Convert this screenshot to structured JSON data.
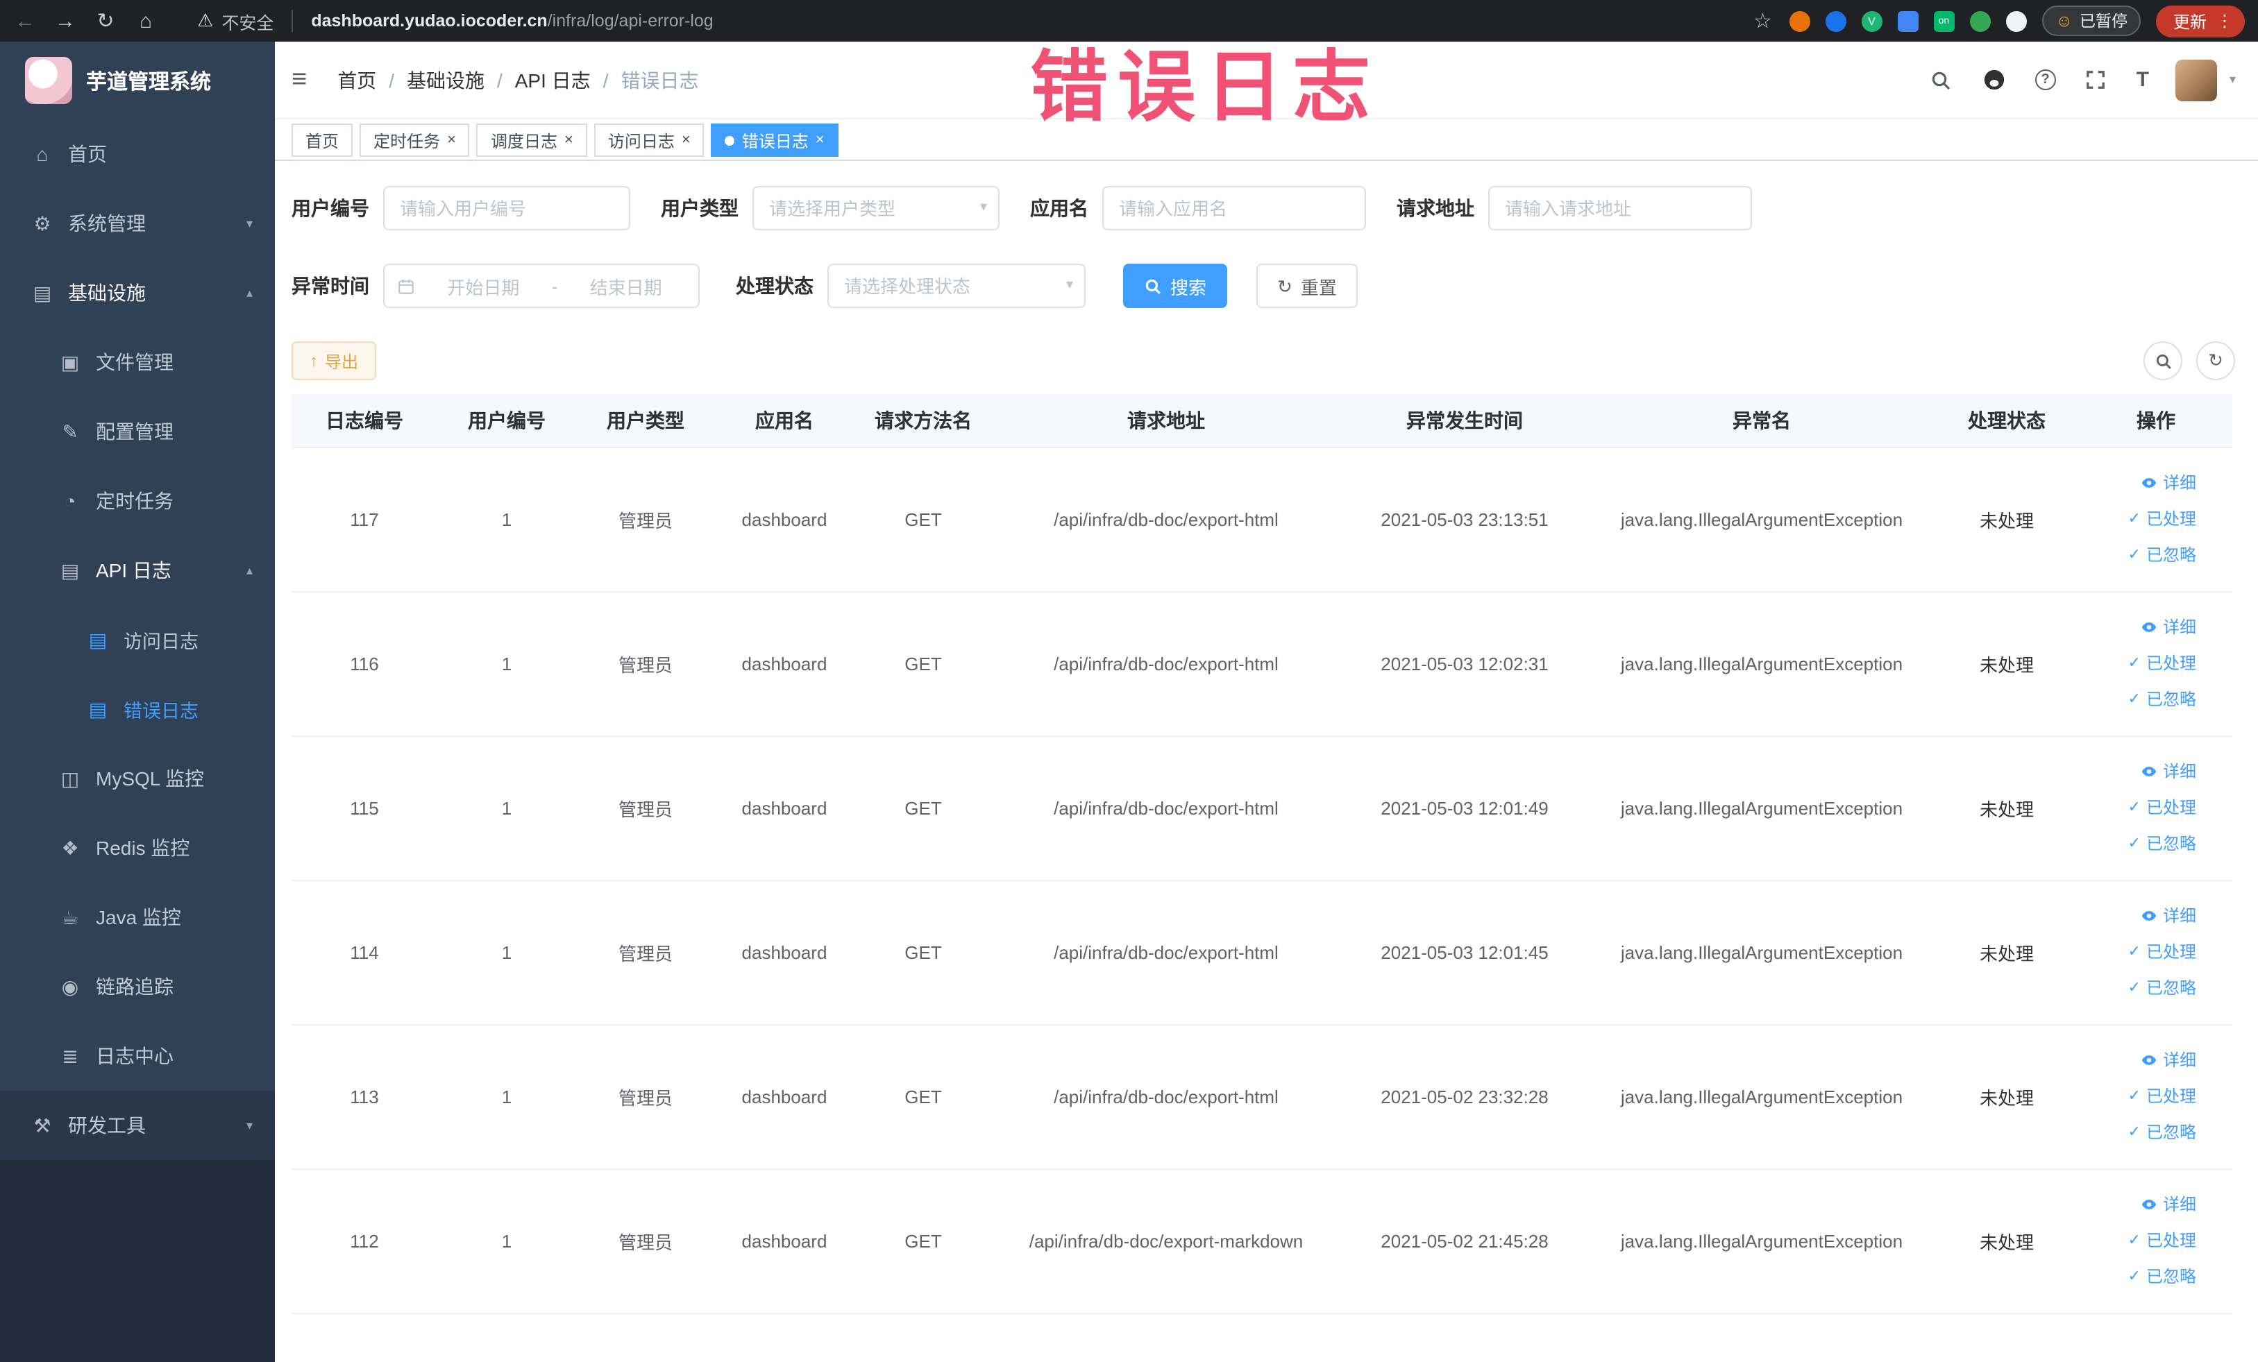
{
  "colors": {
    "accent": "#409eff",
    "warning": "#e6a23c",
    "annotation": "#ef3b63",
    "sidebar_bg": "#304156",
    "active_tab": "#409eff"
  },
  "icons": {
    "back": "←",
    "forward": "→",
    "reload": "↻",
    "home_nav": "⌂",
    "warning": "⚠",
    "star": "☆",
    "dots": "⋮",
    "face": "☺",
    "hamburger": "≡",
    "caret": "▾",
    "chev_down": "▾",
    "chev_up": "▴",
    "home": "⌂",
    "gear": "⚙",
    "infra": "▤",
    "folder": "▣",
    "edit": "✎",
    "clock": "◔",
    "doc": "▤",
    "db": "◫",
    "redis": "❖",
    "java": "☕",
    "trace": "◉",
    "log": "≣",
    "tools": "⚒",
    "check": "✓",
    "export": "↑",
    "refresh": "↻",
    "tsize": "T"
  },
  "browser": {
    "security": "不安全",
    "url_host": "dashboard.yudao.iocoder.cn",
    "url_path": "/infra/log/api-error-log",
    "paused_badge": "已暂停",
    "update_button": "更新"
  },
  "overlay": {
    "title": "错误日志"
  },
  "sidebar": {
    "title": "芋道管理系统",
    "items": [
      {
        "label": "首页"
      },
      {
        "label": "系统管理"
      },
      {
        "label": "基础设施"
      },
      {
        "label": "文件管理"
      },
      {
        "label": "配置管理"
      },
      {
        "label": "定时任务"
      },
      {
        "label": "API 日志"
      },
      {
        "label": "访问日志"
      },
      {
        "label": "错误日志"
      },
      {
        "label": "MySQL 监控"
      },
      {
        "label": "Redis 监控"
      },
      {
        "label": "Java 监控"
      },
      {
        "label": "链路追踪"
      },
      {
        "label": "日志中心"
      },
      {
        "label": "研发工具"
      }
    ]
  },
  "header": {
    "breadcrumbs": [
      "首页",
      "基础设施",
      "API 日志",
      "错误日志"
    ]
  },
  "tabs": [
    {
      "label": "首页"
    },
    {
      "label": "定时任务"
    },
    {
      "label": "调度日志"
    },
    {
      "label": "访问日志"
    },
    {
      "label": "错误日志"
    }
  ],
  "filters": {
    "user_id_label": "用户编号",
    "user_id_placeholder": "请输入用户编号",
    "user_type_label": "用户类型",
    "user_type_placeholder": "请选择用户类型",
    "app_name_label": "应用名",
    "app_name_placeholder": "请输入应用名",
    "request_url_label": "请求地址",
    "request_url_placeholder": "请输入请求地址",
    "time_label": "异常时间",
    "start_placeholder": "开始日期",
    "range_separator": "-",
    "end_placeholder": "结束日期",
    "status_label": "处理状态",
    "status_placeholder": "请选择处理状态",
    "search_button": "搜索",
    "reset_button": "重置"
  },
  "toolbar": {
    "export_button": "导出"
  },
  "table": {
    "columns": [
      "日志编号",
      "用户编号",
      "用户类型",
      "应用名",
      "请求方法名",
      "请求地址",
      "异常发生时间",
      "异常名",
      "处理状态",
      "操作"
    ],
    "actions": {
      "detail": "详细",
      "processed": "已处理",
      "ignored": "已忽略"
    },
    "rows": [
      {
        "id": "117",
        "user_id": "1",
        "user_type": "管理员",
        "app": "dashboard",
        "method": "GET",
        "url": "/api/infra/db-doc/export-html",
        "time": "2021-05-03 23:13:51",
        "exception": "java.lang.IllegalArgumentException",
        "status": "未处理"
      },
      {
        "id": "116",
        "user_id": "1",
        "user_type": "管理员",
        "app": "dashboard",
        "method": "GET",
        "url": "/api/infra/db-doc/export-html",
        "time": "2021-05-03 12:02:31",
        "exception": "java.lang.IllegalArgumentException",
        "status": "未处理"
      },
      {
        "id": "115",
        "user_id": "1",
        "user_type": "管理员",
        "app": "dashboard",
        "method": "GET",
        "url": "/api/infra/db-doc/export-html",
        "time": "2021-05-03 12:01:49",
        "exception": "java.lang.IllegalArgumentException",
        "status": "未处理"
      },
      {
        "id": "114",
        "user_id": "1",
        "user_type": "管理员",
        "app": "dashboard",
        "method": "GET",
        "url": "/api/infra/db-doc/export-html",
        "time": "2021-05-03 12:01:45",
        "exception": "java.lang.IllegalArgumentException",
        "status": "未处理"
      },
      {
        "id": "113",
        "user_id": "1",
        "user_type": "管理员",
        "app": "dashboard",
        "method": "GET",
        "url": "/api/infra/db-doc/export-html",
        "time": "2021-05-02 23:32:28",
        "exception": "java.lang.IllegalArgumentException",
        "status": "未处理"
      },
      {
        "id": "112",
        "user_id": "1",
        "user_type": "管理员",
        "app": "dashboard",
        "method": "GET",
        "url": "/api/infra/db-doc/export-markdown",
        "time": "2021-05-02 21:45:28",
        "exception": "java.lang.IllegalArgumentException",
        "status": "未处理"
      }
    ]
  }
}
